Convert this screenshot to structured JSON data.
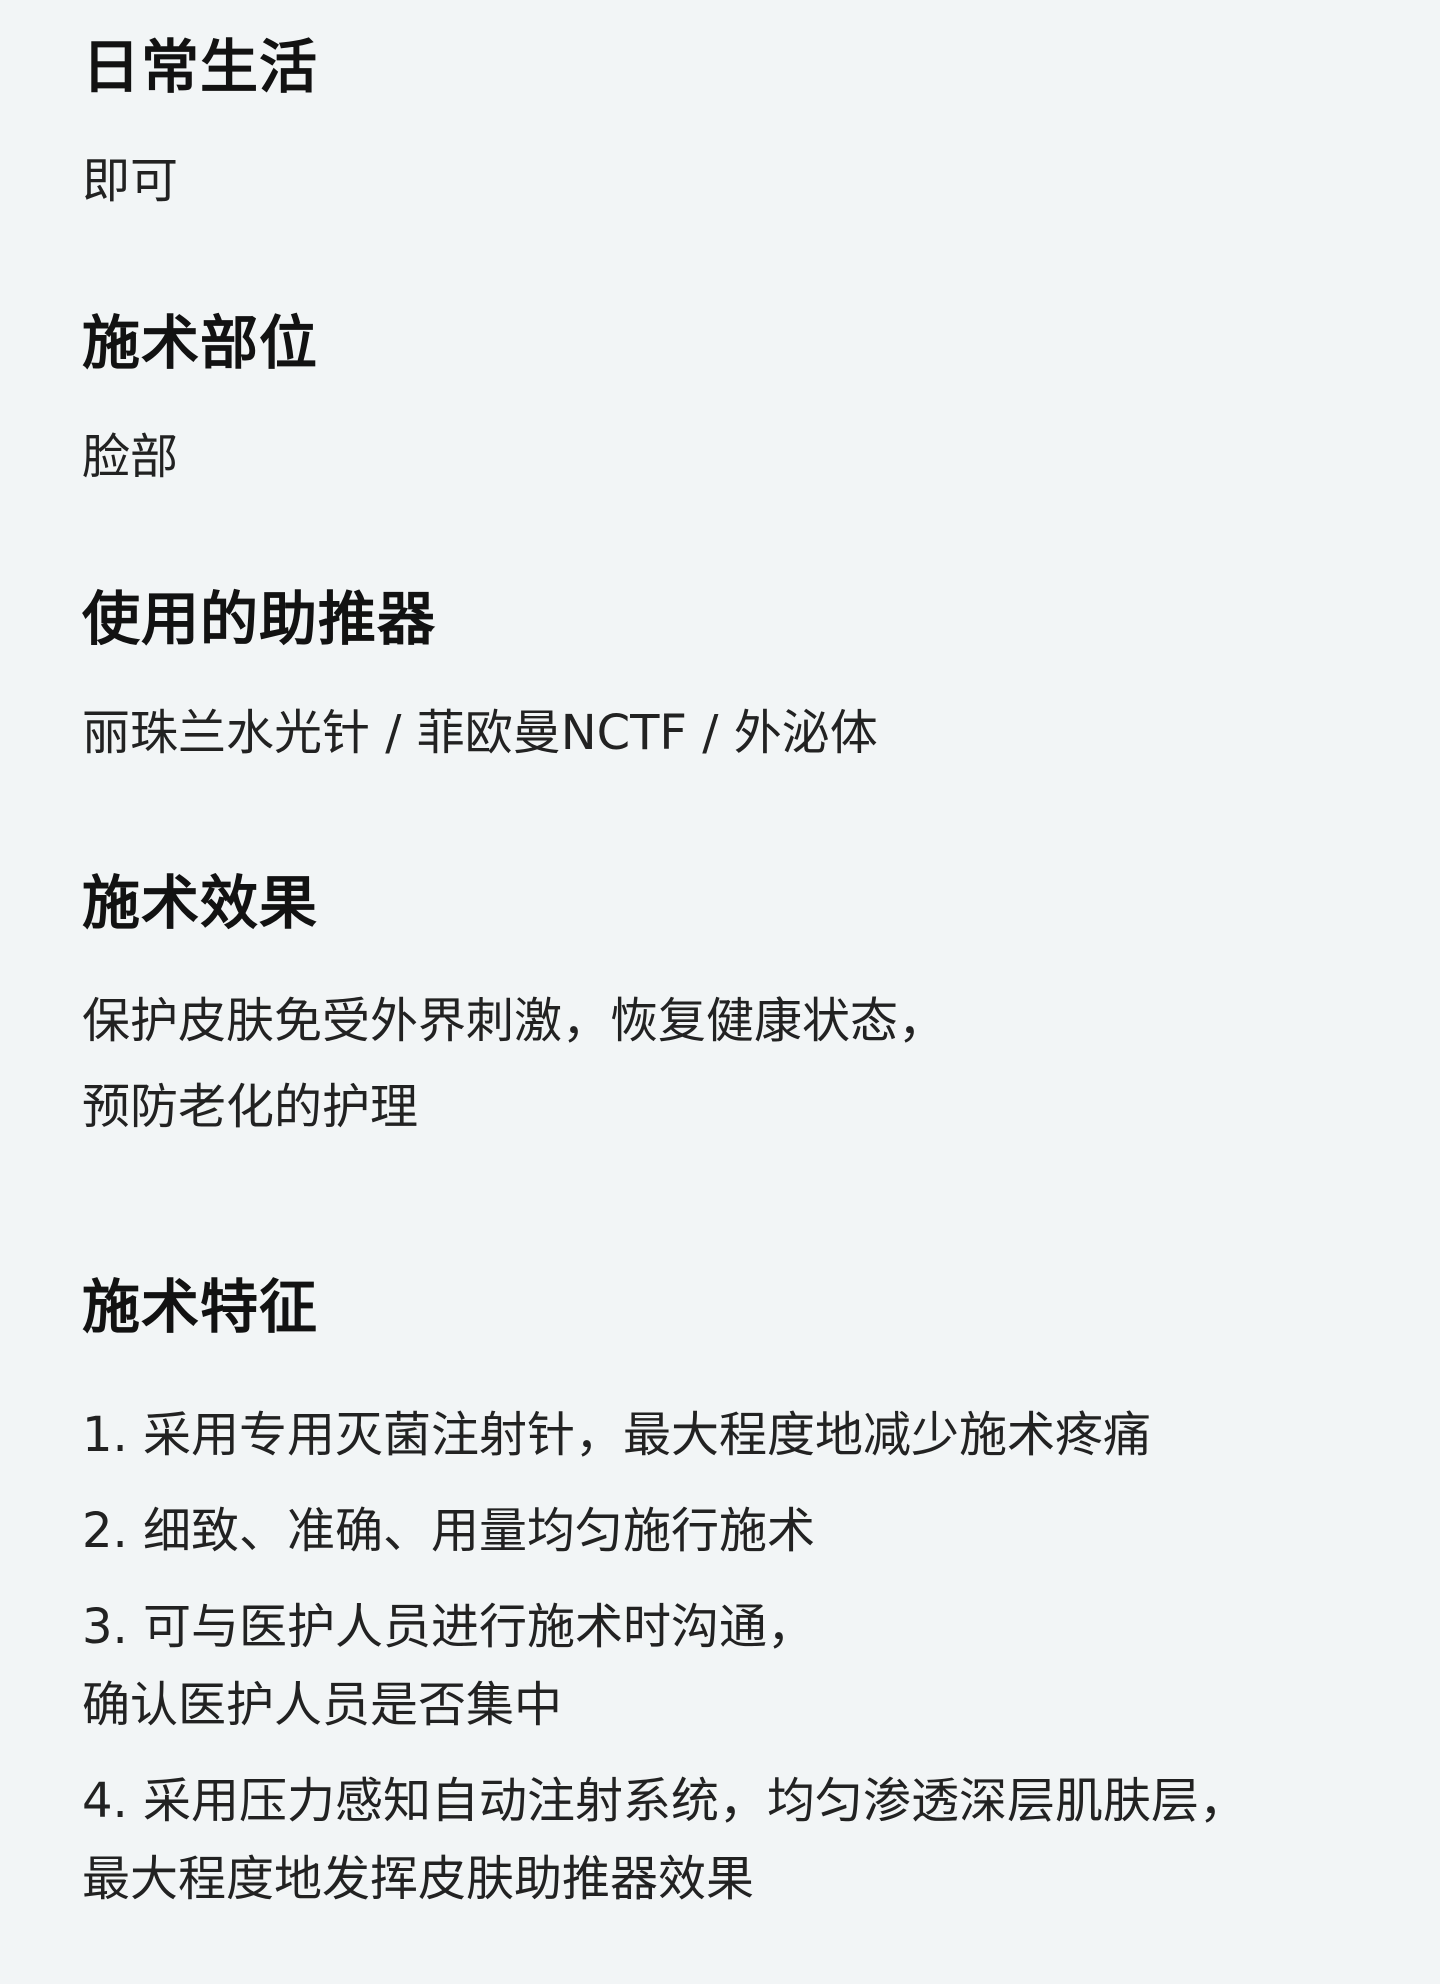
{
  "sections": [
    {
      "heading": "日常生活",
      "body": "即可"
    },
    {
      "heading": "施术部位",
      "body": "脸部"
    },
    {
      "heading": "使用的助推器",
      "body": "丽珠兰水光针 / 菲欧曼NCTF / 外泌体"
    },
    {
      "heading": "施术效果",
      "body_lines": [
        "保护皮肤免受外界刺激，恢复健康状态，",
        "预防老化的护理"
      ]
    },
    {
      "heading": "施术特征",
      "items": [
        {
          "lines": [
            "1. 采用专用灭菌注射针，最大程度地减少施术疼痛"
          ]
        },
        {
          "lines": [
            "2. 细致、准确、用量均匀施行施术"
          ]
        },
        {
          "lines": [
            "3. 可与医护人员进行施术时沟通，",
            "确认医护人员是否集中"
          ]
        },
        {
          "lines": [
            "4. 采用压力感知自动注射系统，均匀渗透深层肌肤层，",
            "最大程度地发挥皮肤助推器效果"
          ]
        }
      ]
    }
  ]
}
